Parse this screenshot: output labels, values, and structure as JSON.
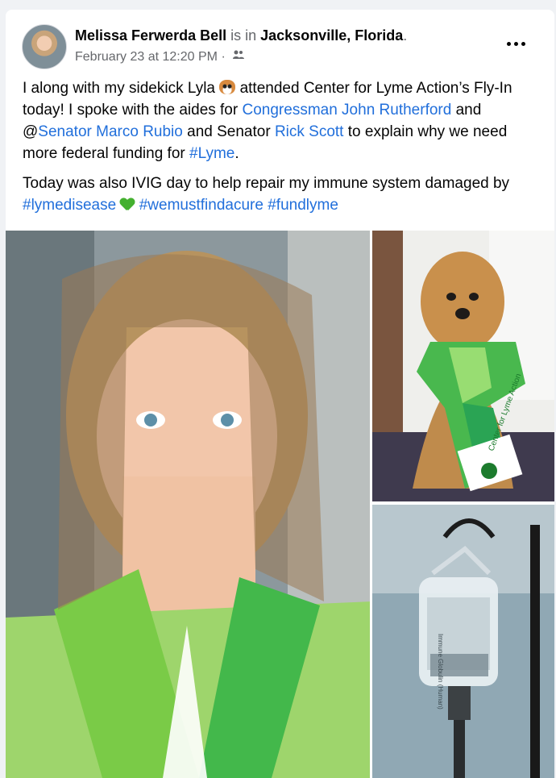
{
  "post": {
    "author": "Melissa Ferwerda Bell",
    "is_in": "is in",
    "location": "Jacksonville, Florida",
    "period": ".",
    "timestamp": "February 23 at 12:20 PM",
    "audience_separator": "·",
    "audience_icon": "friends-icon",
    "text_p1": {
      "a": "I along with my sidekick Lyla ",
      "emoji_dog": "dog-face-emoji",
      "b": " attended Center for Lyme Action’s Fly-In today! I spoke with the aides for ",
      "link1": "Congressman John Rutherford",
      "c": " and @",
      "link2": "Senator Marco Rubio",
      "d": " and Senator ",
      "link3": "Rick Scott",
      "e": " to explain why we need more federal funding for ",
      "link4": "#Lyme",
      "f": "."
    },
    "text_p2": {
      "a": "Today was also IVIG day to help repair my immune system damaged by ",
      "link1": "#lymedisease",
      "emoji_heart": "green-heart-emoji",
      "link2": "#wemustfindacure",
      "link3": "#fundlyme"
    }
  },
  "photos": {
    "left": {
      "alt": "woman-smiling-green-scarf"
    },
    "top_right": {
      "alt": "dog-wearing-green-scarf",
      "scarf_text_1": "Center for Lyme Action",
      "scarf_text_2": "Center for Lyme Action"
    },
    "bottom_right": {
      "alt": "iv-bag-on-stand",
      "bag_text": "Immune Globulin (Human)"
    }
  },
  "colors": {
    "link": "#216fdb",
    "muted": "#65676b",
    "background": "#f0f2f5"
  }
}
